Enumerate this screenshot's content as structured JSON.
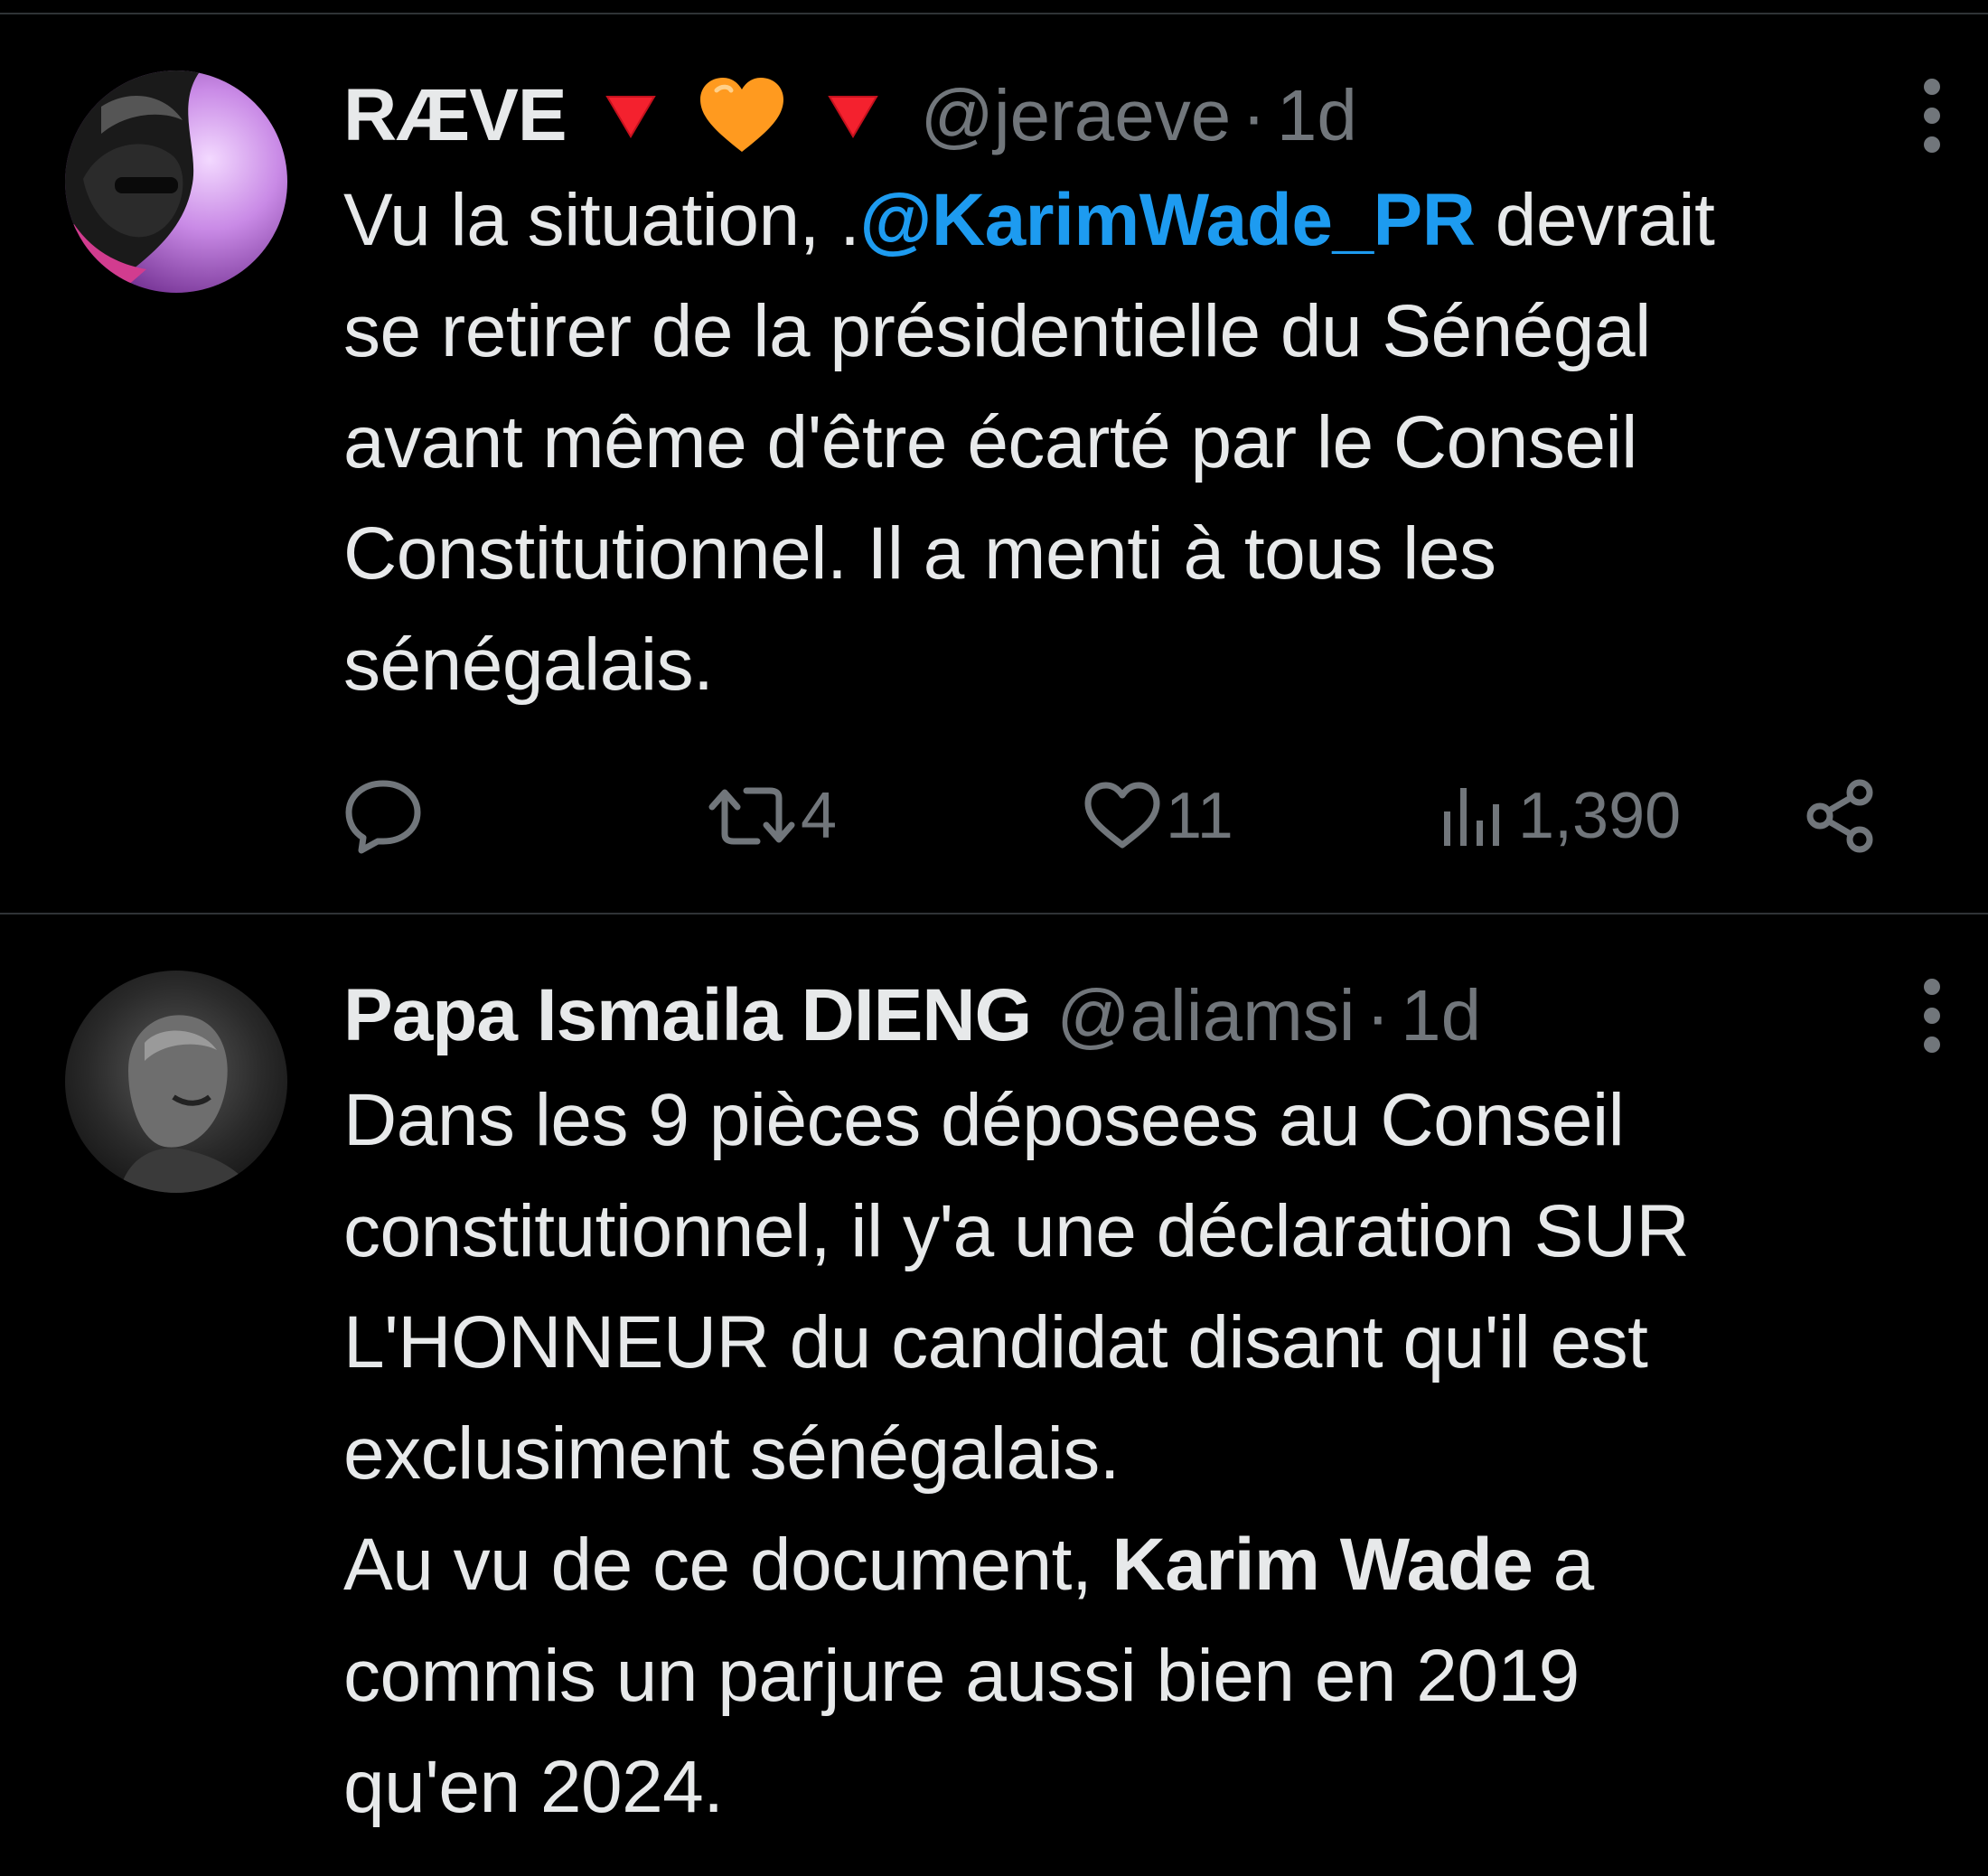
{
  "tweets": [
    {
      "author_name": "RÆVE",
      "badges": [
        "red-triangle-down-icon",
        "orange-heart-icon",
        "red-triangle-down-icon"
      ],
      "handle": "@jeraeve",
      "separator": "·",
      "time": "1d",
      "body": {
        "lead": "Vu la situation, .",
        "mention": "@KarimWade_PR",
        "rest": " devrait\nse retirer de la présidentielle du Sénégal\navant même d'être écarté par le Conseil\nConstitutionnel. Il a menti à tous les\nsénégalais."
      },
      "actions": {
        "reply_count": "",
        "retweet_count": "4",
        "like_count": "11",
        "view_count": "1,390"
      },
      "avatar_colors": [
        "#d8a6f0",
        "#8a3fa8"
      ]
    },
    {
      "author_name": "Papa Ismaila DIENG",
      "handle": "@aliamsi",
      "separator": "·",
      "time": "1d",
      "body": {
        "lead": "Dans les 9 pièces déposees au Conseil\nconstitutionnel, il y'a une déclaration SUR\nL'HONNEUR du candidat disant qu'il est\nexclusiment sénégalais.\nAu vu de ce document, ",
        "bold": "Karim Wade",
        "rest": " a\ncommis un parjure aussi bien en 2019\nqu'en 2024."
      }
    }
  ],
  "colors": {
    "background": "#000000",
    "text": "#e7e9ea",
    "muted": "#71767b",
    "link": "#1d9bf0",
    "divider": "#2f3336",
    "badge_red": "#f4212e",
    "badge_orange": "#ff8c1a"
  }
}
